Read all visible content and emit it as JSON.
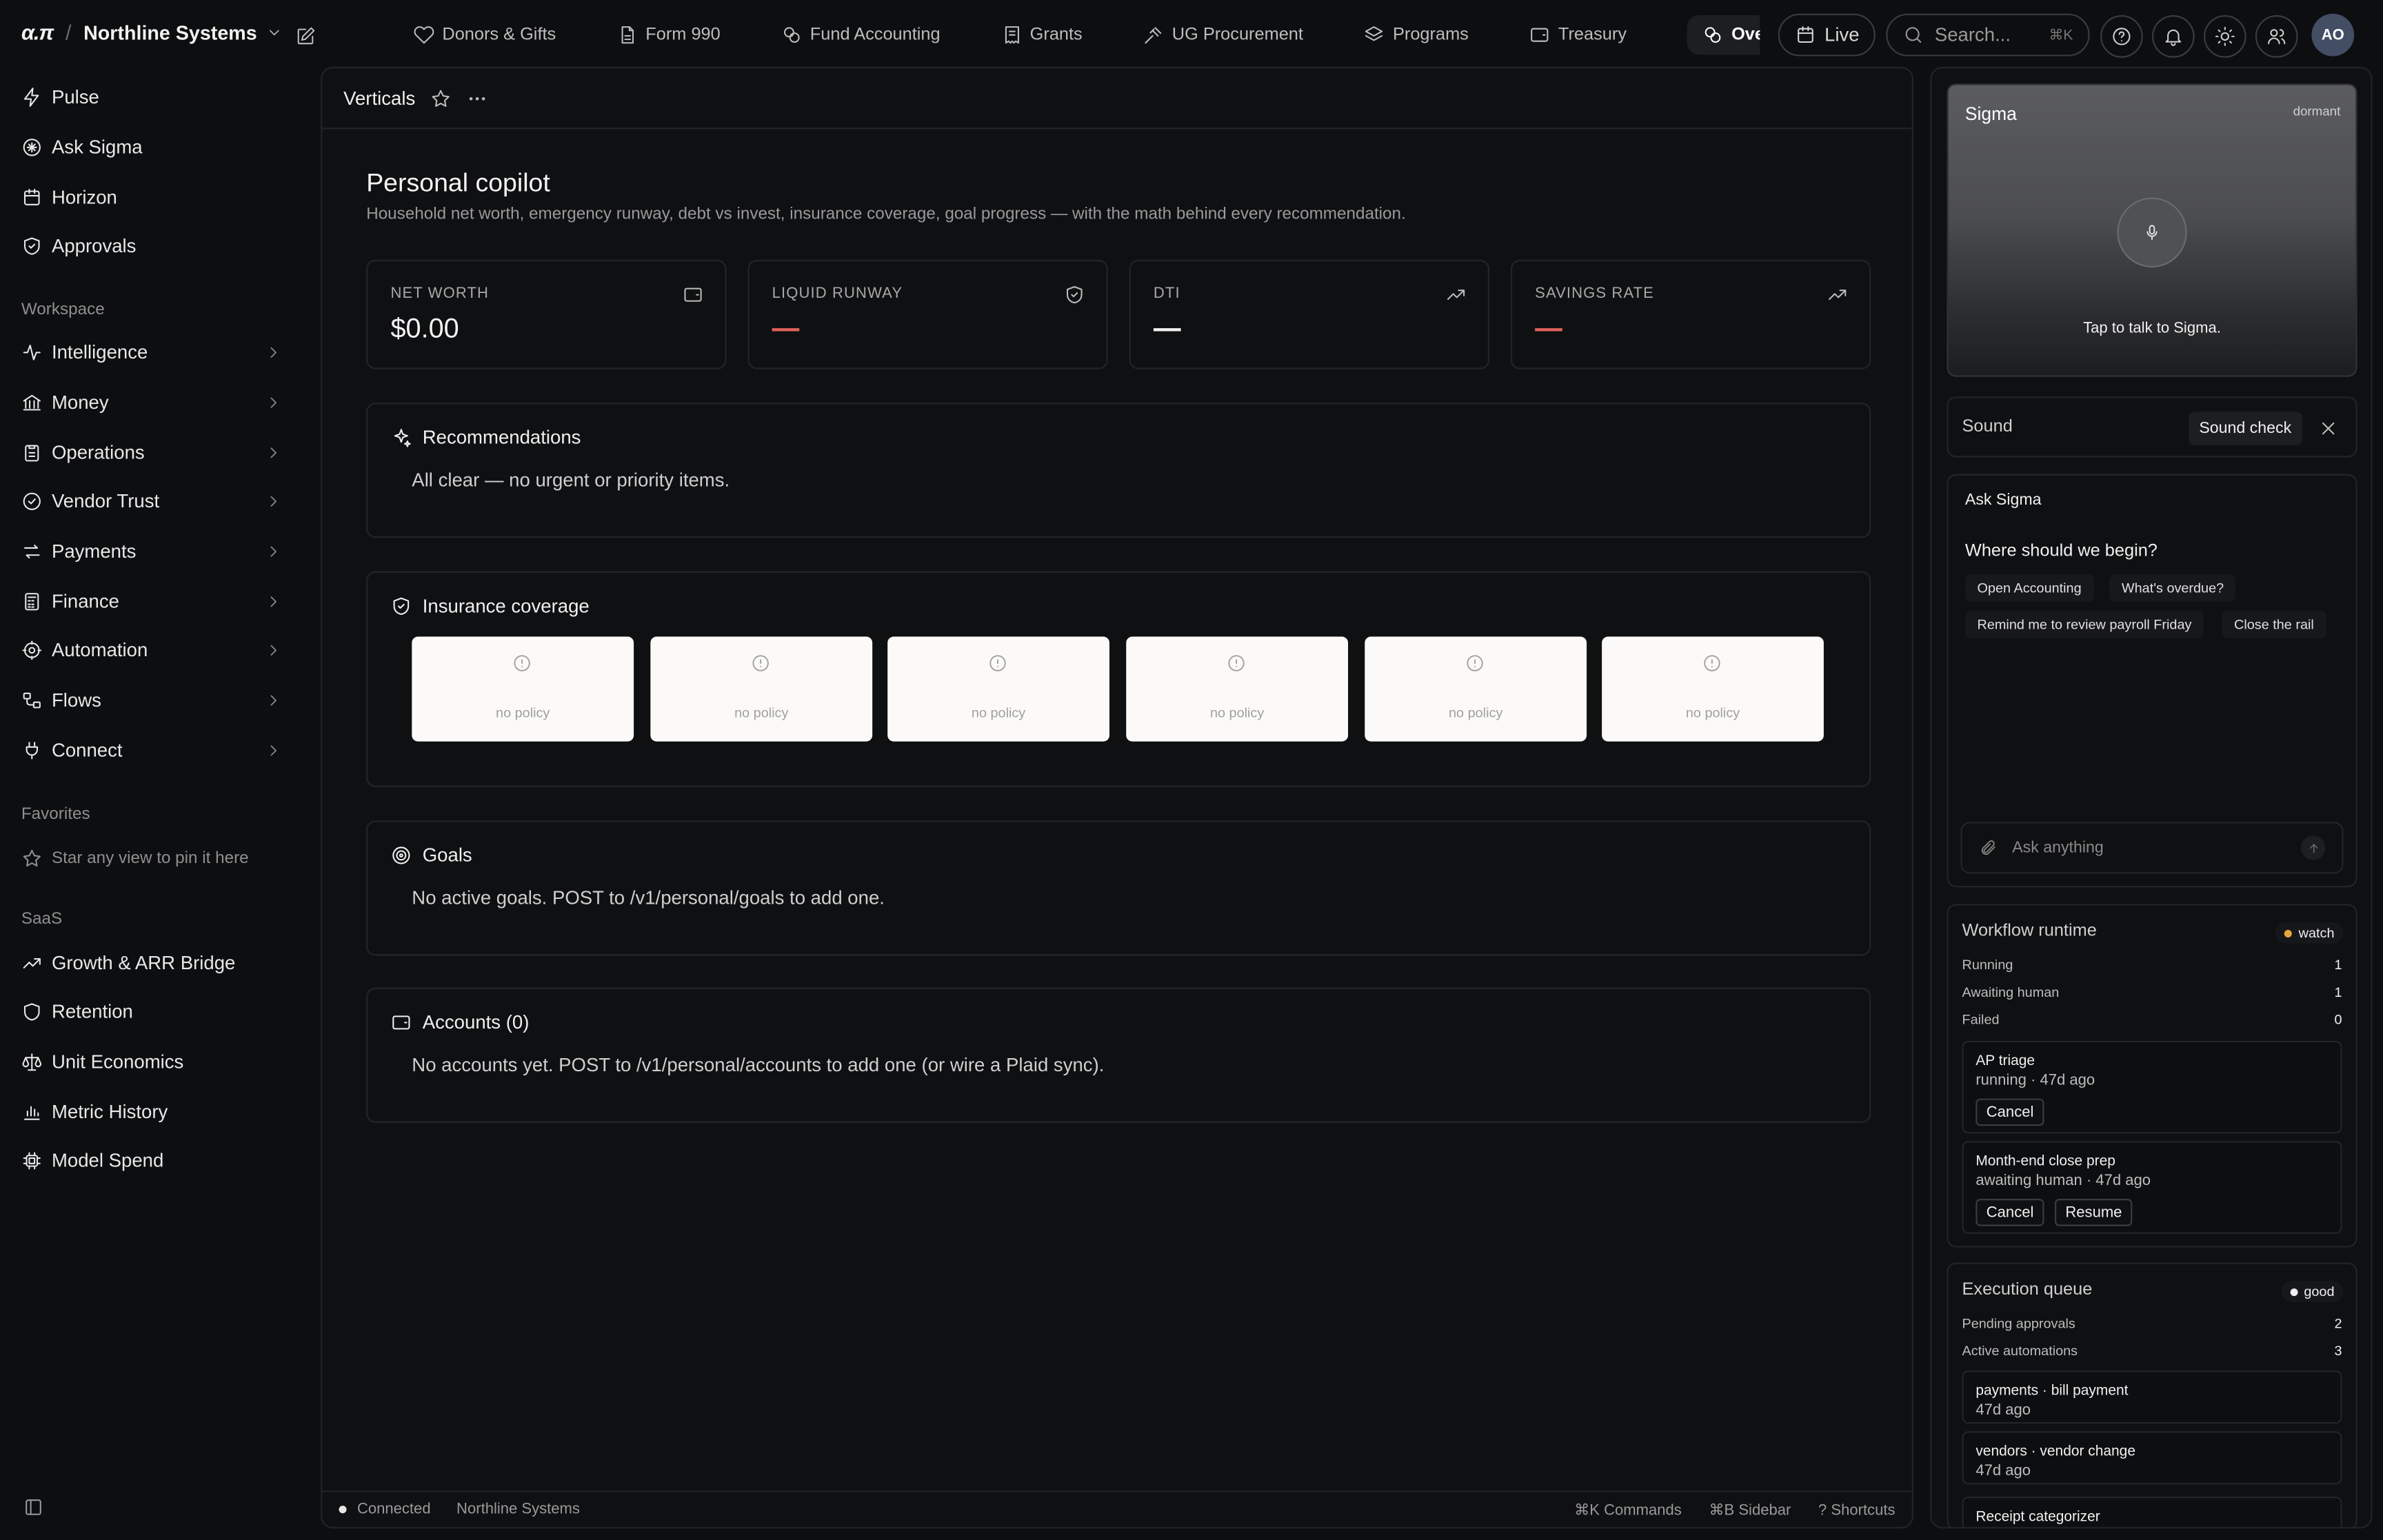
{
  "brand": {
    "logo": "α.π",
    "org": "Northline Systems"
  },
  "nav_tabs": [
    {
      "label": "Donors & Gifts",
      "icon": "heart-icon"
    },
    {
      "label": "Form 990",
      "icon": "document-icon"
    },
    {
      "label": "Fund Accounting",
      "icon": "coins-icon"
    },
    {
      "label": "Grants",
      "icon": "receipt-icon"
    },
    {
      "label": "UG Procurement",
      "icon": "gavel-icon"
    },
    {
      "label": "Programs",
      "icon": "layers-icon"
    },
    {
      "label": "Treasury",
      "icon": "wallet-icon"
    },
    {
      "label": "Overvie",
      "icon": "coins-icon"
    }
  ],
  "topbar": {
    "live_label": "Live",
    "search_placeholder": "Search...",
    "search_shortcut": "⌘K",
    "avatar_initials": "AO"
  },
  "sidebar": {
    "primary": [
      {
        "label": "Pulse",
        "icon": "bolt-icon"
      },
      {
        "label": "Ask Sigma",
        "icon": "sparkle-icon"
      },
      {
        "label": "Horizon",
        "icon": "calendar-icon"
      },
      {
        "label": "Approvals",
        "icon": "shield-check-icon"
      }
    ],
    "workspace_heading": "Workspace",
    "workspace": [
      {
        "label": "Intelligence",
        "icon": "activity-icon"
      },
      {
        "label": "Money",
        "icon": "bank-icon"
      },
      {
        "label": "Operations",
        "icon": "clipboard-icon"
      },
      {
        "label": "Vendor Trust",
        "icon": "badge-check-icon"
      },
      {
        "label": "Payments",
        "icon": "arrows-icon"
      },
      {
        "label": "Finance",
        "icon": "calculator-icon"
      },
      {
        "label": "Automation",
        "icon": "gear-icon"
      },
      {
        "label": "Flows",
        "icon": "workflow-icon"
      },
      {
        "label": "Connect",
        "icon": "plug-icon"
      }
    ],
    "favorites_heading": "Favorites",
    "favorites_hint": "Star any view to pin it here",
    "saas_heading": "SaaS",
    "saas": [
      {
        "label": "Growth & ARR Bridge",
        "icon": "trending-up-icon"
      },
      {
        "label": "Retention",
        "icon": "shield-icon"
      },
      {
        "label": "Unit Economics",
        "icon": "scale-icon"
      },
      {
        "label": "Metric History",
        "icon": "bar-chart-icon"
      },
      {
        "label": "Model Spend",
        "icon": "chip-icon"
      }
    ]
  },
  "main": {
    "breadcrumb": "Verticals",
    "title": "Personal copilot",
    "subtitle": "Household net worth, emergency runway, debt vs invest, insurance coverage, goal progress — with the math behind every recommendation.",
    "kpis": [
      {
        "label": "NET WORTH",
        "value": "$0.00",
        "icon": "wallet-icon",
        "dash_color": ""
      },
      {
        "label": "LIQUID RUNWAY",
        "value": "",
        "icon": "shield-icon",
        "dash_color": "#e0625a"
      },
      {
        "label": "DTI",
        "value": "",
        "icon": "trending-up-icon",
        "dash_color": "#f0f0f0"
      },
      {
        "label": "SAVINGS RATE",
        "value": "",
        "icon": "trending-up-icon",
        "dash_color": "#e0625a"
      }
    ],
    "recommendations": {
      "title": "Recommendations",
      "text": "All clear — no urgent or priority items."
    },
    "insurance": {
      "title": "Insurance coverage",
      "policies": [
        "no policy",
        "no policy",
        "no policy",
        "no policy",
        "no policy",
        "no policy"
      ]
    },
    "goals": {
      "title": "Goals",
      "text": "No active goals. POST to /v1/personal/goals to add one."
    },
    "accounts": {
      "title": "Accounts (0)",
      "text": "No accounts yet. POST to /v1/personal/accounts to add one (or wire a Plaid sync)."
    }
  },
  "statusbar": {
    "connection": "Connected",
    "org": "Northline Systems",
    "commands": "⌘K Commands",
    "sidebar": "⌘B Sidebar",
    "shortcuts": "? Shortcuts"
  },
  "rail": {
    "voice": {
      "title": "Sigma",
      "state": "dormant",
      "hint": "Tap to talk to Sigma."
    },
    "sound": {
      "label": "Sound",
      "button": "Sound check"
    },
    "ask": {
      "title": "Ask Sigma",
      "question": "Where should we begin?",
      "chips": [
        "Open Accounting",
        "What's overdue?",
        "Remind me to review payroll Friday",
        "Close the rail"
      ],
      "placeholder": "Ask anything"
    },
    "workflow": {
      "title": "Workflow runtime",
      "status": "watch",
      "status_color": "#e8a53c",
      "rows": [
        {
          "label": "Running",
          "value": "1"
        },
        {
          "label": "Awaiting human",
          "value": "1"
        },
        {
          "label": "Failed",
          "value": "0"
        }
      ],
      "items": [
        {
          "name": "AP triage",
          "sub": "running · 47d ago",
          "actions": [
            "Cancel"
          ]
        },
        {
          "name": "Month-end close prep",
          "sub": "awaiting human · 47d ago",
          "actions": [
            "Cancel",
            "Resume"
          ]
        }
      ]
    },
    "queue": {
      "title": "Execution queue",
      "status": "good",
      "status_color": "#f0f0f0",
      "rows": [
        {
          "label": "Pending approvals",
          "value": "2"
        },
        {
          "label": "Active automations",
          "value": "3"
        }
      ],
      "items": [
        {
          "name": "payments · bill payment",
          "sub": "47d ago"
        },
        {
          "name": "vendors · vendor change",
          "sub": "47d ago"
        },
        {
          "name": "Receipt categorizer",
          "sub": ""
        }
      ]
    }
  }
}
